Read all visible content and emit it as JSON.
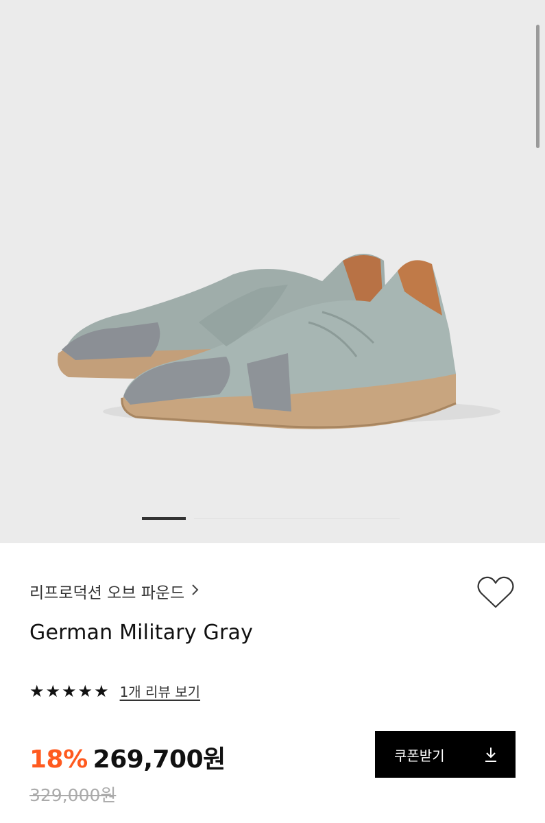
{
  "product": {
    "brand": "리프로덕션 오브 파운드",
    "title": "German Military Gray",
    "rating_stars": 5,
    "review_link": "1개 리뷰 보기",
    "discount": "18%",
    "price": "269,700원",
    "original_price": "329,000원"
  },
  "gallery": {
    "image_alt": "gray sneakers photo",
    "current_slide": 1
  },
  "actions": {
    "coupon_label": "쿠폰받기",
    "coupon_icon": "download-icon",
    "wishlist_icon": "heart-icon",
    "brand_icon": "chevron-right-icon"
  },
  "colors": {
    "discount": "#ff5a1f",
    "button_bg": "#000000",
    "gallery_bg": "#ebebeb"
  }
}
